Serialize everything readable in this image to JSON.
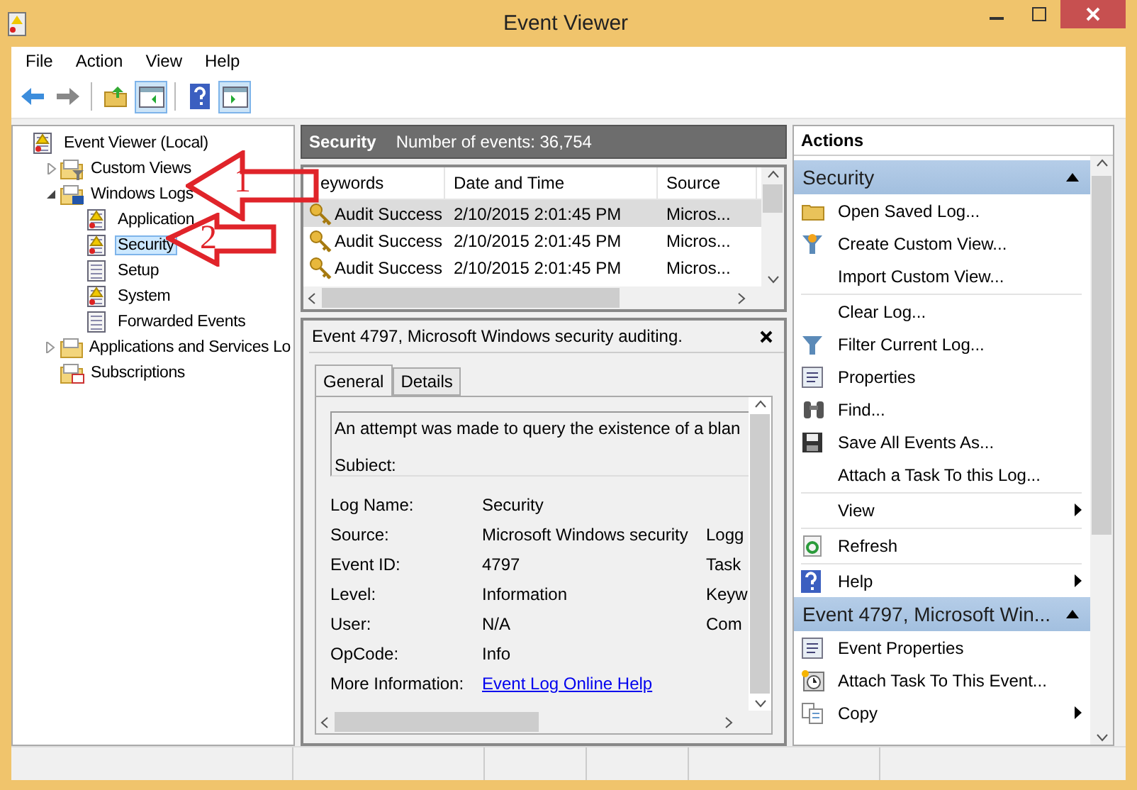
{
  "window": {
    "title": "Event Viewer"
  },
  "menu": [
    "File",
    "Action",
    "View",
    "Help"
  ],
  "tree": [
    {
      "label": "Event Viewer (Local)",
      "selected": false,
      "children": [
        {
          "label": "Custom Views",
          "selected": false,
          "expanded": false
        },
        {
          "label": "Windows Logs",
          "selected": false,
          "expanded": true,
          "children": [
            {
              "label": "Application",
              "selected": false
            },
            {
              "label": "Security",
              "selected": true
            },
            {
              "label": "Setup",
              "selected": false
            },
            {
              "label": "System",
              "selected": false
            },
            {
              "label": "Forwarded Events",
              "selected": false
            }
          ]
        },
        {
          "label": "Applications and Services Lo",
          "selected": false,
          "expanded": false
        },
        {
          "label": "Subscriptions",
          "selected": false
        }
      ]
    }
  ],
  "log_header": {
    "title": "Security",
    "count": "Number of events: 36,754"
  },
  "table": {
    "columns": [
      "eywords",
      "Date and Time",
      "Source"
    ],
    "rows": [
      {
        "cells": [
          "Audit Success",
          "2/10/2015 2:01:45 PM",
          "Micros..."
        ],
        "selected": true
      },
      {
        "cells": [
          "Audit Success",
          "2/10/2015 2:01:45 PM",
          "Micros..."
        ],
        "selected": false
      },
      {
        "cells": [
          "Audit Success",
          "2/10/2015 2:01:45 PM",
          "Micros..."
        ],
        "selected": false
      }
    ]
  },
  "event": {
    "title": "Event 4797, Microsoft Windows security auditing.",
    "tabs": [
      {
        "label": "General",
        "selected": true
      },
      {
        "label": "Details",
        "selected": false
      }
    ],
    "description": "An attempt was made to query the existence of a blan",
    "subject": "Subiect:",
    "fields": [
      {
        "label": "Log Name:",
        "value": "Security"
      },
      {
        "label": "Source:",
        "value": "Microsoft Windows security",
        "extra": "Logg"
      },
      {
        "label": "Event ID:",
        "value": "4797",
        "extra": "Task"
      },
      {
        "label": "Level:",
        "value": "Information",
        "extra": "Keyw"
      },
      {
        "label": "User:",
        "value": "N/A",
        "extra": "Com"
      },
      {
        "label": "OpCode:",
        "value": "Info"
      },
      {
        "label": "More Information:",
        "value": "Event Log Online Help",
        "kind": "link"
      }
    ]
  },
  "actions": {
    "title": "Actions",
    "sections": [
      {
        "title": "Security",
        "collapsed": false,
        "items": [
          {
            "label": "Open Saved Log...",
            "submenu": false,
            "divider_above": false
          },
          {
            "label": "Create Custom View...",
            "submenu": false,
            "divider_above": false
          },
          {
            "label": "Import Custom View...",
            "submenu": false,
            "divider_above": false
          },
          {
            "label": "Clear Log...",
            "submenu": false,
            "divider_above": true
          },
          {
            "label": "Filter Current Log...",
            "submenu": false,
            "divider_above": false
          },
          {
            "label": "Properties",
            "submenu": false,
            "divider_above": false
          },
          {
            "label": "Find...",
            "submenu": false,
            "divider_above": false
          },
          {
            "label": "Save All Events As...",
            "submenu": false,
            "divider_above": false
          },
          {
            "label": "Attach a Task To this Log...",
            "submenu": false,
            "divider_above": false
          },
          {
            "label": "View",
            "submenu": true,
            "divider_above": true
          },
          {
            "label": "Refresh",
            "submenu": false,
            "divider_above": true
          },
          {
            "label": "Help",
            "submenu": true,
            "divider_above": true
          }
        ]
      },
      {
        "title": "Event 4797, Microsoft Win...",
        "collapsed": false,
        "items": [
          {
            "label": "Event Properties",
            "submenu": false,
            "divider_above": false
          },
          {
            "label": "Attach Task To This Event...",
            "submenu": false,
            "divider_above": false
          },
          {
            "label": "Copy",
            "submenu": true,
            "divider_above": false
          }
        ]
      }
    ]
  },
  "annotations": [
    {
      "label": "1"
    },
    {
      "label": "2"
    }
  ]
}
